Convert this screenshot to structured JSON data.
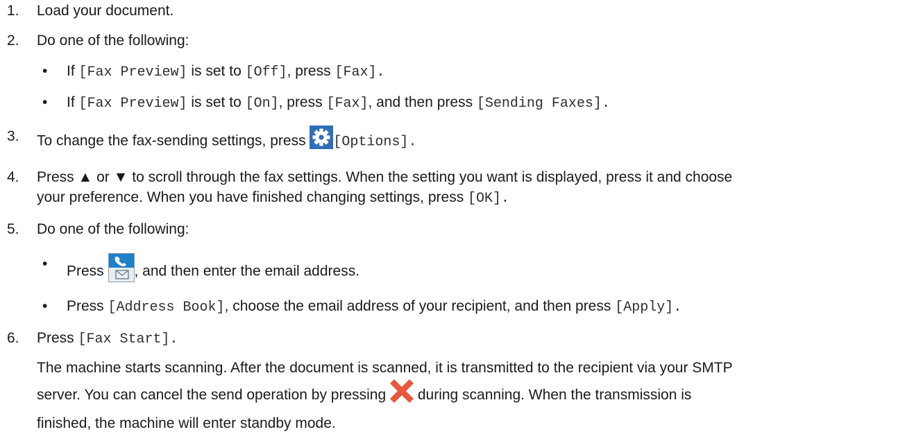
{
  "steps": [
    {
      "num": "1.",
      "text": "Load your document."
    },
    {
      "num": "2.",
      "text": "Do one of the following:",
      "bullets": [
        {
          "t1": "If ",
          "c1": "[Fax Preview]",
          "t2": " is set to ",
          "c2": "[Off]",
          "t3": ", press ",
          "c3": "[Fax]",
          "t4": "."
        },
        {
          "t1": "If ",
          "c1": "[Fax Preview]",
          "t2": " is set to ",
          "c2": "[On]",
          "t3": ", press ",
          "c3": "[Fax]",
          "t4": ", and then press ",
          "c4": "[Sending Faxes]",
          "t5": "."
        }
      ]
    },
    {
      "num": "3.",
      "t1": "To change the fax-sending settings, press ",
      "c1": "[Options]",
      "t2": "."
    },
    {
      "num": "4.",
      "line1": "Press ▲ or ▼ to scroll through the fax settings. When the setting you want is displayed, press it and choose",
      "line2a": "your preference. When you have finished changing settings, press ",
      "c1": "[OK]",
      "line2b": "."
    },
    {
      "num": "5.",
      "text": "Do one of the following:",
      "bullets": [
        {
          "t1": "Press ",
          "t2": ", and then enter the email address."
        },
        {
          "t1": "Press ",
          "c1": "[Address Book]",
          "t2": ", choose the email address of your recipient, and then press ",
          "c2": "[Apply]",
          "t3": "."
        }
      ]
    },
    {
      "num": "6.",
      "t1": "Press ",
      "c1": "[Fax Start]",
      "t2": ".",
      "para_line1": "The machine starts scanning. After the document is scanned, it is transmitted to the recipient via your SMTP",
      "para_line2a": "server. You can cancel the send operation by pressing ",
      "para_line2b": " during scanning. When the transmission is",
      "para_line3": "finished, the machine will enter standby mode."
    }
  ],
  "bullet_char": "•",
  "icons": {
    "options": "gear-icon",
    "fax_email": "phone-envelope-icon",
    "stop": "x-stop-icon"
  },
  "colors": {
    "gear_bg": "#2f6fb7",
    "fax_bg": "#1f7fc9",
    "stop": "#e9573f"
  }
}
